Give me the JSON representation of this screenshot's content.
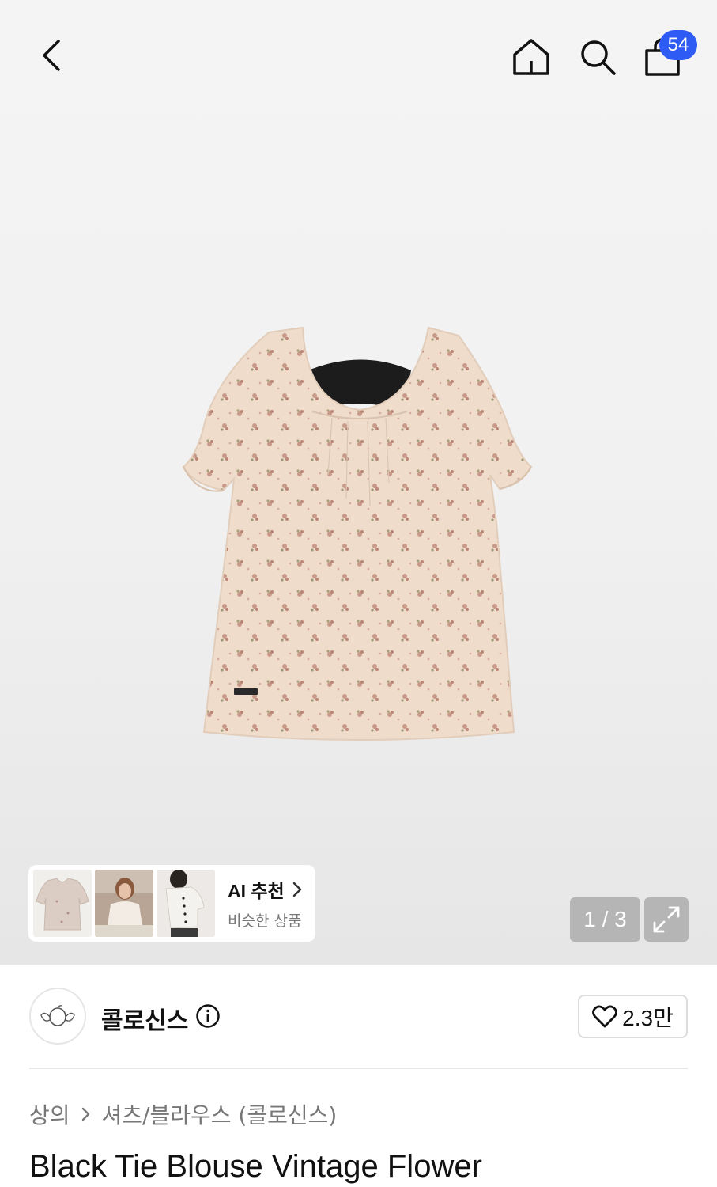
{
  "header": {
    "cart_count": "54"
  },
  "ai_recommend": {
    "title": "AI 추천",
    "subtitle": "비슷한 상품"
  },
  "gallery": {
    "counter": "1 / 3"
  },
  "brand": {
    "name": "콜로신스",
    "likes": "2.3만"
  },
  "breadcrumb": {
    "category": "상의",
    "subcategory": "셔츠/블라우스 (콜로신스)"
  },
  "product": {
    "title": "Black Tie Blouse Vintage Flower"
  },
  "icons": {
    "back": "chevron-left-icon",
    "home": "home-icon",
    "search": "search-icon",
    "cart": "shopping-bag-icon",
    "expand": "expand-icon",
    "heart": "heart-icon",
    "info": "info-icon"
  },
  "colors": {
    "badge": "#2f5bf5",
    "blouse": "#efdccb",
    "flower": "#c9998a"
  }
}
